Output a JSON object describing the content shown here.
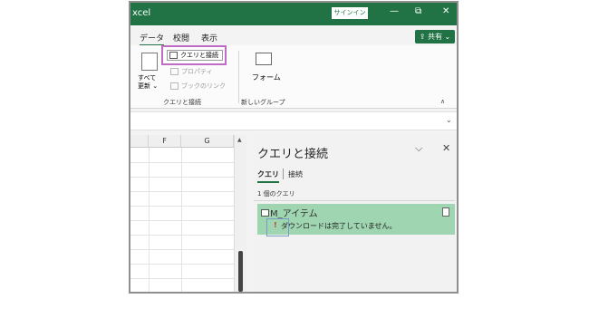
{
  "window": {
    "title": "xcel",
    "signin": "サインイン",
    "minimize": "—",
    "restore": "⧉",
    "close": "✕"
  },
  "tabs": [
    {
      "label": "データ",
      "active": true
    },
    {
      "label": "校閲",
      "active": false
    },
    {
      "label": "表示",
      "active": false
    }
  ],
  "share": "⇪ 共有 ⌄",
  "ribbon": {
    "refresh_all": "すべて\n更新 ⌄",
    "queries_and_connections": "クエリと接続",
    "properties": "プロパティ",
    "edit_links": "ブックのリンク",
    "group_label": "クエリと接続",
    "forms": "フォーム",
    "forms_group_label": "新しいグループ"
  },
  "grid": {
    "columns": [
      "F",
      "G"
    ]
  },
  "pane": {
    "title": "クエリと接続",
    "tabs": [
      {
        "label": "クエリ",
        "active": true
      },
      {
        "label": "接続",
        "active": false
      }
    ],
    "count": "1 個のクエリ",
    "queries": [
      {
        "name": "M_アイテム",
        "status": "ダウンロードは完了していません。"
      }
    ]
  },
  "colors": {
    "accent": "#217346",
    "highlight": "#c06bc4",
    "row_selected": "#9fd5b0"
  }
}
